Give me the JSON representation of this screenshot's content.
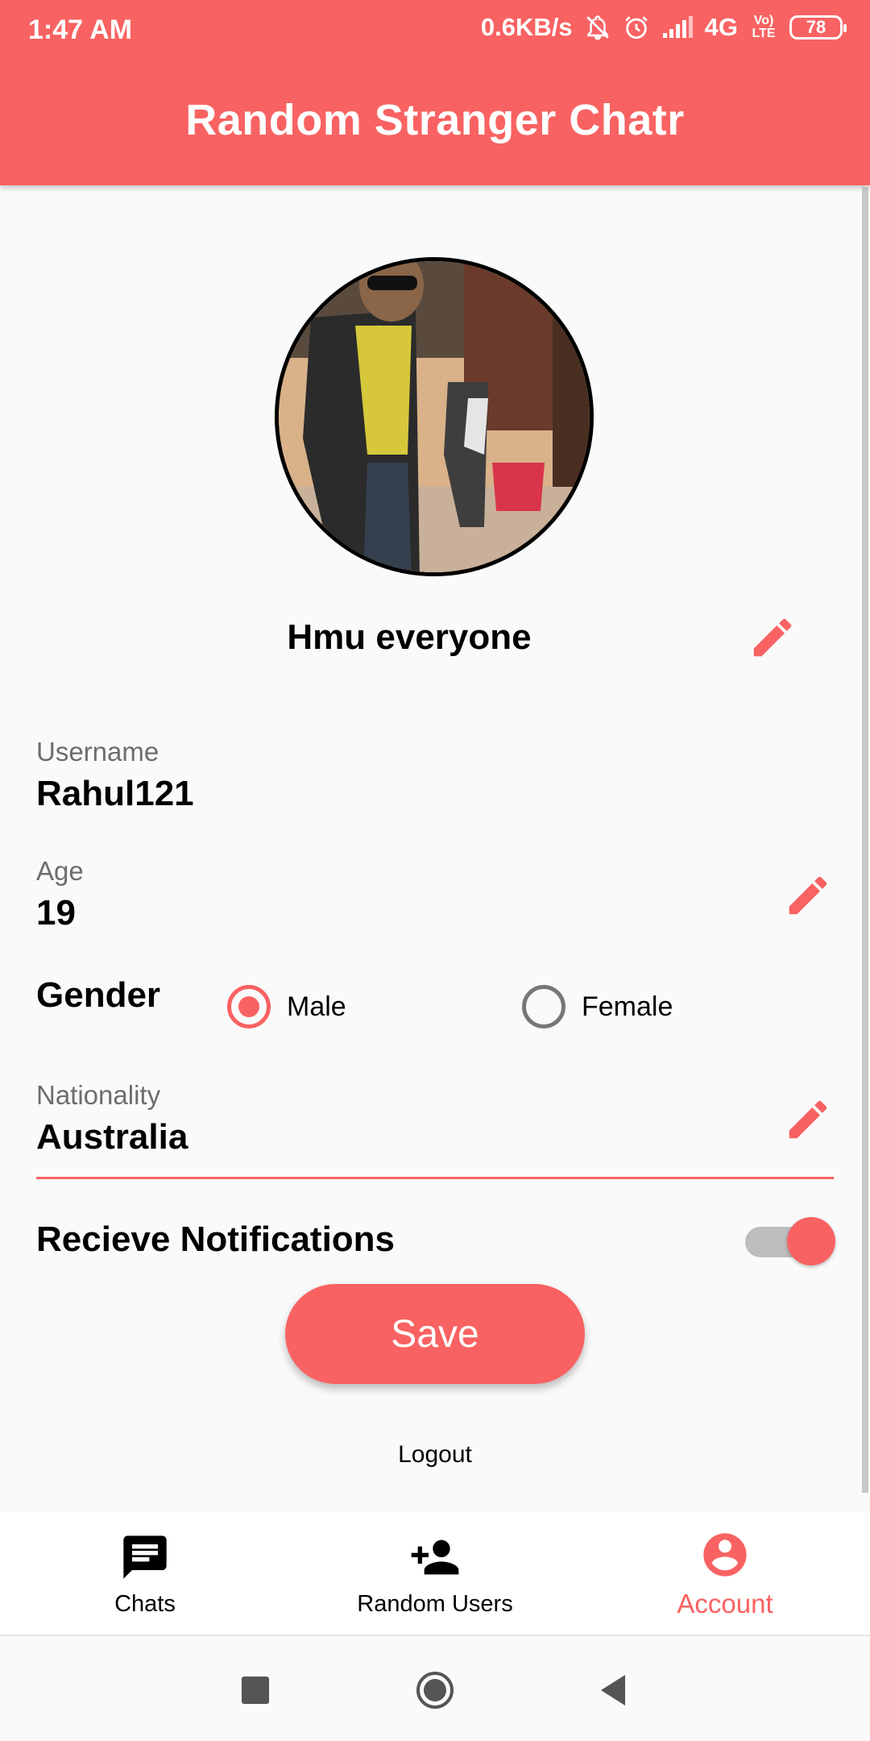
{
  "status_bar": {
    "time": "1:47 AM",
    "net_speed": "0.6KB/s",
    "network": "4G",
    "volte": "Vo) LTE",
    "battery": "78"
  },
  "app_bar": {
    "title": "Random Stranger Chatr"
  },
  "profile": {
    "status_message": "Hmu everyone",
    "username_label": "Username",
    "username": "Rahul121",
    "age_label": "Age",
    "age": "19",
    "gender_label": "Gender",
    "gender_options": [
      "Male",
      "Female"
    ],
    "gender_selected": "Male",
    "nationality_label": "Nationality",
    "nationality": "Australia",
    "notifications_label": "Recieve Notifications",
    "notifications_enabled": true,
    "save_label": "Save",
    "logout_label": "Logout"
  },
  "bottom_nav": {
    "items": [
      {
        "label": "Chats",
        "icon": "chat-icon"
      },
      {
        "label": "Random Users",
        "icon": "add-person-icon"
      },
      {
        "label": "Account",
        "icon": "account-icon",
        "active": true
      }
    ]
  },
  "system_nav": {
    "icons": [
      "recents-icon",
      "home-icon",
      "back-icon"
    ]
  },
  "colors": {
    "accent": "#f96262",
    "background": "#fafafa",
    "label_gray": "#6d6d6d"
  }
}
